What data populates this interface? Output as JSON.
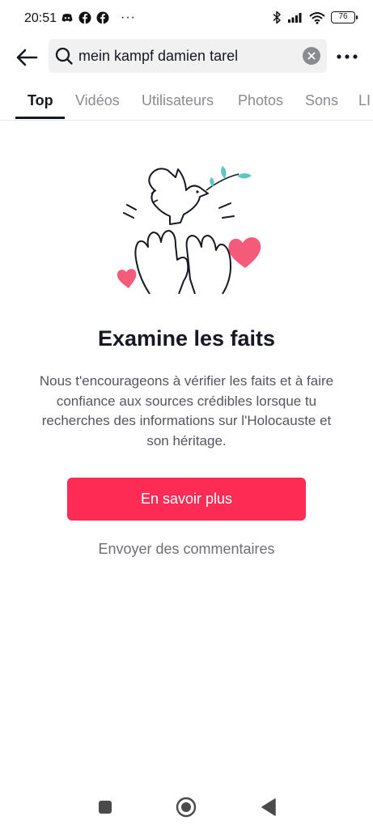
{
  "status_bar": {
    "time": "20:51",
    "left_icons": [
      "discord-icon",
      "facebook-icon",
      "facebook-icon"
    ],
    "overflow": "···",
    "right_icons": [
      "bluetooth-icon",
      "signal-icon",
      "wifi-icon"
    ],
    "battery": "76"
  },
  "search": {
    "query": "mein kampf damien tarel"
  },
  "tabs": [
    {
      "label": "Top",
      "active": true
    },
    {
      "label": "Vidéos",
      "active": false
    },
    {
      "label": "Utilisateurs",
      "active": false
    },
    {
      "label": "Photos",
      "active": false
    },
    {
      "label": "Sons",
      "active": false
    },
    {
      "label": "LI",
      "active": false
    }
  ],
  "notice": {
    "title": "Examine les faits",
    "description": "Nous t'encourageons à vérifier les faits et à faire confiance aux sources crédibles lorsque tu recherches des informations sur l'Holocauste et son héritage.",
    "button_label": "En savoir plus",
    "feedback_label": "Envoyer des commentaires"
  },
  "colors": {
    "accent": "#fe2c55",
    "heart": "#f45b7a",
    "leaf": "#5cc8c6",
    "text_primary": "#161823",
    "text_secondary": "#55565e"
  },
  "nav": [
    "square-icon",
    "home-circle-icon",
    "back-triangle-icon"
  ]
}
